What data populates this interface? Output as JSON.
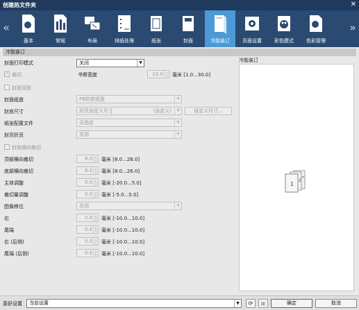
{
  "window": {
    "title": "创建热文件夹",
    "close_glyph": "✕"
  },
  "toolbar": {
    "prev_glyph": "«",
    "next_glyph": "»",
    "tabs": [
      {
        "label": "基本",
        "icon": "basic-icon"
      },
      {
        "label": "常规",
        "icon": "general-icon"
      },
      {
        "label": "布局",
        "icon": "layout-icon"
      },
      {
        "label": "排纸处理",
        "icon": "output-icon"
      },
      {
        "label": "纸张",
        "icon": "paper-icon"
      },
      {
        "label": "封面",
        "icon": "cover-icon"
      },
      {
        "label": "冷胶装订",
        "icon": "perfect-binding-icon"
      },
      {
        "label": "页面设置",
        "icon": "page-setup-icon"
      },
      {
        "label": "彩色模式",
        "icon": "color-mode-icon"
      },
      {
        "label": "色彩管理",
        "icon": "color-management-icon"
      }
    ],
    "active_tab": "冷胶装订"
  },
  "section": {
    "title": "冷胶装订"
  },
  "form": {
    "cover_print_mode": {
      "label": "封面打印模式",
      "value": "关闭"
    },
    "trim": {
      "label": "裁切",
      "checked": true
    },
    "spine_width": {
      "label": "书脊宽度",
      "value": "10.0",
      "unit": "毫米 [1.0...30.0]"
    },
    "cover_duplex": {
      "label": "封面双面",
      "checked": false
    },
    "cover_tray": {
      "label": "封面纸盘",
      "value": "PB封皮纸盘"
    },
    "cover_size": {
      "label": "封皮尺寸",
      "value": "封页自定义尺寸",
      "extra": "(自定义)",
      "button": "自定义尺寸..."
    },
    "paper_profile": {
      "label": "纸张配置文件",
      "value": "无指定"
    },
    "cover_fold": {
      "label": "封页折页",
      "value": "关闭"
    },
    "cover_horizontal_trim": {
      "label": "封面横向裁切",
      "checked": false
    },
    "top_trim": {
      "label": "顶部横向裁切",
      "value": "8.0",
      "unit": "毫米 [8.0...26.0]"
    },
    "bottom_trim": {
      "label": "底部横向裁切",
      "value": "8.0",
      "unit": "毫米 [8.0...26.0]"
    },
    "main_adjust": {
      "label": "主体调整",
      "value": "0.0",
      "unit": "毫米 [-20.0...5.0]"
    },
    "trim_adjust": {
      "label": "裁切量调整",
      "value": "0.0",
      "unit": "毫米 [-5.0...5.0]"
    },
    "image_shift": {
      "label": "图像移位",
      "value": "关闭"
    },
    "right": {
      "label": "右",
      "value": "0.0",
      "unit": "毫米 [-10.0...10.0]"
    },
    "tail": {
      "label": "尾端",
      "value": "0.0",
      "unit": "毫米 [-10.0...10.0]"
    },
    "right_back": {
      "label": "右 (后侧)",
      "value": "0.0",
      "unit": "毫米 [-10.0...10.0]"
    },
    "tail_back": {
      "label": "尾端 (后侧)",
      "value": "0.0",
      "unit": "毫米 [-10.0...10.0]"
    }
  },
  "preview": {
    "title": "冷胶装订",
    "page1": "1",
    "page2": "2",
    "page3": "n"
  },
  "footer": {
    "favorites_label": "喜好设置",
    "favorites_value": "当前设置",
    "refresh_glyph": "⟳",
    "save_glyph": "▣",
    "ok": "确定",
    "cancel": "取消"
  },
  "colors": {
    "titlebar": "#1f3a5c",
    "toolbar": "#2a4a72",
    "active_tab": "#4b9ad6"
  }
}
